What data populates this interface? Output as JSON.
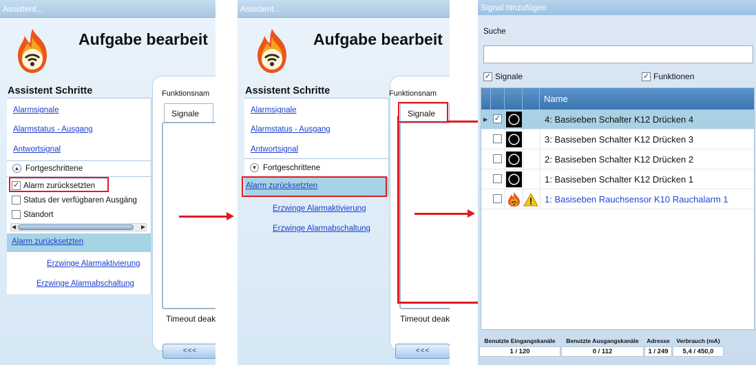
{
  "panels": [
    {
      "title": "Assistent...",
      "header": "Aufgabe bearbeit",
      "steps_title": "Assistent Schritte",
      "links": [
        "Alarmsignale",
        "Alarmstatus - Ausgang",
        "Antwortsignal"
      ],
      "expander": "Fortgeschrittene",
      "options": [
        {
          "label": "Alarm zurücksetzten",
          "checked": true
        },
        {
          "label": "Status der verfügbaren Ausgäng",
          "checked": false
        },
        {
          "label": "Standort",
          "checked": false
        }
      ],
      "active_step": "Alarm zurücksetzten",
      "sub_links": [
        "Erzwinge Alarmaktivierung",
        "Erzwinge Alarmabschaltung"
      ],
      "function_label": "Funktionsnam",
      "tab_label": "Signale",
      "timeout_label": "Timeout deak",
      "back_button": "<<<"
    },
    {
      "title": "Assistent...",
      "header": "Aufgabe bearbeit",
      "steps_title": "Assistent Schritte",
      "links": [
        "Alarmsignale",
        "Alarmstatus - Ausgang",
        "Antwortsignal"
      ],
      "expander": "Fortgeschrittene",
      "active_step": "Alarm zurücksetzten",
      "sub_links": [
        "Erzwinge Alarmaktivierung",
        "Erzwinge Alarmabschaltung"
      ],
      "function_label": "Funktionsnam",
      "tab_label": "Signale",
      "timeout_label": "Timeout deak",
      "back_button": "<<<"
    }
  ],
  "dialog": {
    "title": "Signal hinzufügen",
    "search_label": "Suche",
    "search_value": "",
    "filter_signals": "Signale",
    "filter_functions": "Funktionen",
    "column_name": "Name",
    "rows": [
      {
        "name": "4: Basiseben Schalter K12 Drücken 4",
        "checked": true,
        "selected": true,
        "icon": "switch-icon"
      },
      {
        "name": "3: Basiseben Schalter K12 Drücken 3",
        "checked": false,
        "selected": false,
        "icon": "switch-icon"
      },
      {
        "name": "2: Basiseben Schalter K12 Drücken 2",
        "checked": false,
        "selected": false,
        "icon": "switch-icon"
      },
      {
        "name": "1: Basiseben Schalter K12 Drücken 1",
        "checked": false,
        "selected": false,
        "icon": "switch-icon"
      },
      {
        "name": "1: Basiseben Rauchsensor K10 Rauchalarm 1",
        "checked": false,
        "selected": false,
        "icon": "smoke-sensor-icon"
      }
    ],
    "footer": {
      "input_channels_label": "Benutzte Eingangskanäle",
      "input_channels_value": "1 / 120",
      "output_channels_label": "Benutzte Ausgangskanäle",
      "output_channels_value": "0 / 112",
      "address_label": "Adresse",
      "address_value": "1 / 249",
      "consumption_label": "Verbrauch (mA)",
      "consumption_value": "5,4 / 450,0"
    }
  },
  "colors": {
    "highlight": "#e11a22",
    "link": "#1a3fcc",
    "grid_header": "#3b76b1",
    "selected_row": "#a9d1e4"
  }
}
